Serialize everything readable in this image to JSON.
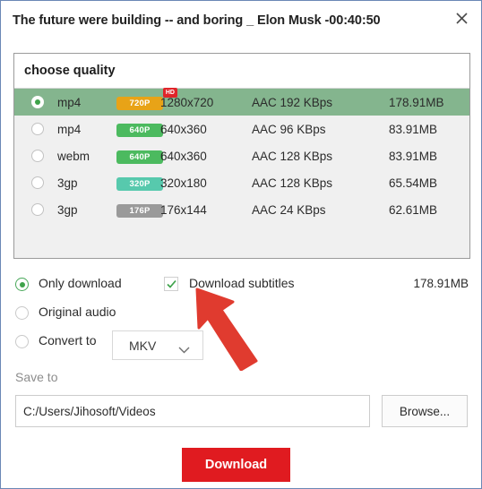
{
  "dialog": {
    "title": "The future were building -- and boring _ Elon Musk  -00:40:50",
    "close_icon": "close-icon"
  },
  "quality": {
    "header_label": "choose quality",
    "rows": [
      {
        "format": "mp4",
        "badge": "720P",
        "badge_color": "#e8a317",
        "hd_tag": "HD",
        "resolution": "1280x720",
        "audio": "AAC 192 KBps",
        "size": "178.91MB",
        "selected": true
      },
      {
        "format": "mp4",
        "badge": "640P",
        "badge_color": "#4cba5f",
        "hd_tag": "",
        "resolution": "640x360",
        "audio": "AAC 96 KBps",
        "size": "83.91MB",
        "selected": false
      },
      {
        "format": "webm",
        "badge": "640P",
        "badge_color": "#4cba5f",
        "hd_tag": "",
        "resolution": "640x360",
        "audio": "AAC 128 KBps",
        "size": "83.91MB",
        "selected": false
      },
      {
        "format": "3gp",
        "badge": "320P",
        "badge_color": "#57c9ad",
        "hd_tag": "",
        "resolution": "320x180",
        "audio": "AAC 128 KBps",
        "size": "65.54MB",
        "selected": false
      },
      {
        "format": "3gp",
        "badge": "176P",
        "badge_color": "#9a9a9a",
        "hd_tag": "",
        "resolution": "176x144",
        "audio": "AAC 24 KBps",
        "size": "62.61MB",
        "selected": false
      }
    ]
  },
  "options": {
    "only_download_label": "Only download",
    "original_audio_label": "Original audio",
    "convert_to_label": "Convert to",
    "convert_format": "MKV",
    "subtitles_label": "Download subtitles",
    "total_size": "178.91MB"
  },
  "save": {
    "label": "Save to",
    "path": "C:/Users/Jihosoft/Videos",
    "browse_label": "Browse..."
  },
  "actions": {
    "download_label": "Download"
  },
  "colors": {
    "selected_row": "#84b58e",
    "download_button": "#e01b20",
    "accent_green": "#3ea34a",
    "arrow_red": "#e03b2f",
    "dialog_border": "#6b87b5"
  }
}
